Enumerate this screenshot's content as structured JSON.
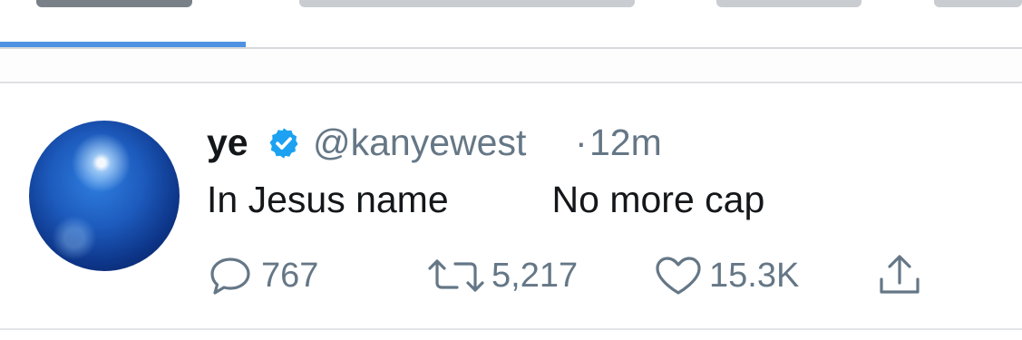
{
  "tabs": [
    {
      "label": ""
    },
    {
      "label": ""
    },
    {
      "label": ""
    },
    {
      "label": ""
    }
  ],
  "tweet": {
    "author_name": "ye",
    "verified": true,
    "handle": "@kanyewest",
    "separator": "·",
    "time": "12m",
    "text": "In Jesus name          No more cap",
    "replies": "767",
    "retweets": "5,217",
    "likes": "15.3K"
  },
  "colors": {
    "accent": "#4f92e3",
    "verified_badge": "#1da1f2",
    "secondary_text": "#657786",
    "primary_text": "#14171a"
  },
  "icons": {
    "reply": "speech-bubble-icon",
    "retweet": "retweet-arrows-icon",
    "like": "heart-outline-icon",
    "share": "share-upload-icon",
    "verified": "verified-badge-icon"
  }
}
